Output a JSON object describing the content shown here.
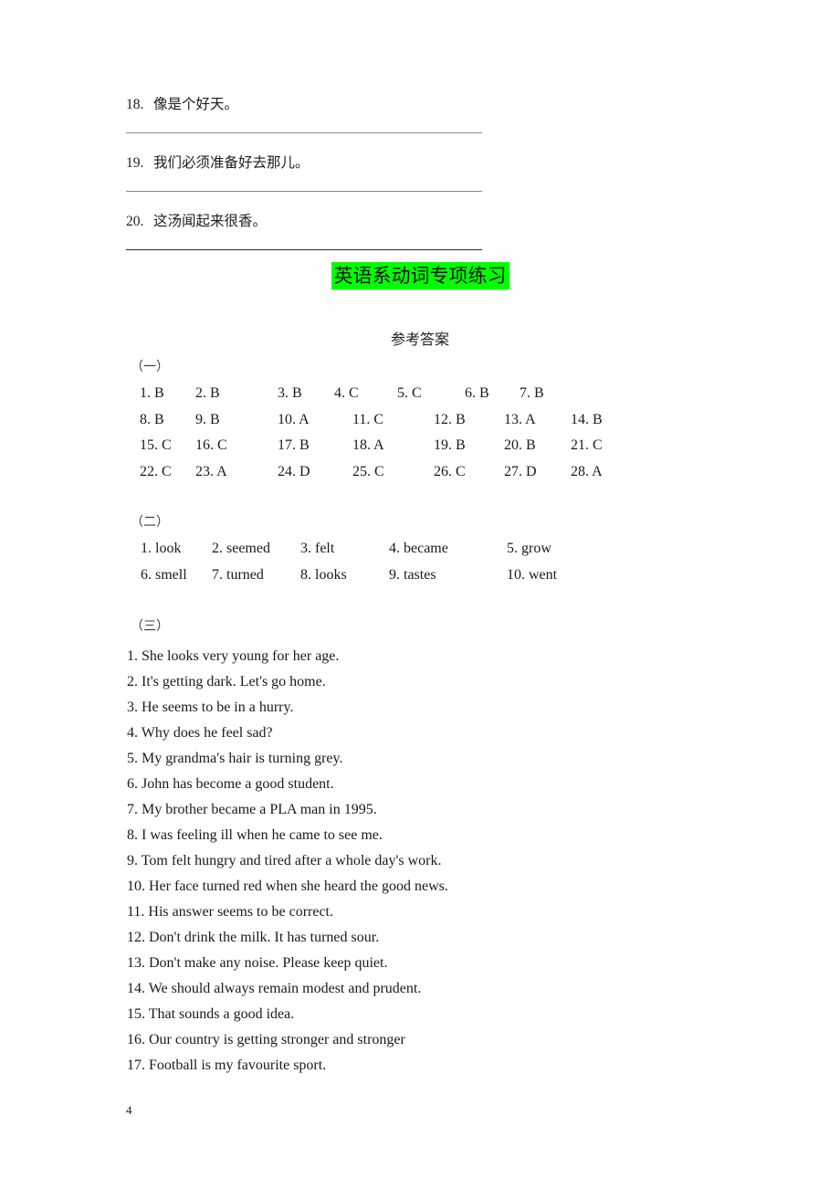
{
  "document": {
    "title_highlighted": "英语系动词专项练习",
    "highlight_color": "#00ff00",
    "answers_heading": "参考答案",
    "page_number": "4"
  },
  "translation_exercise": {
    "items": [
      {
        "number": "18.",
        "text": "像是个好天。"
      },
      {
        "number": "19.",
        "text": "我们必须准备好去那儿。"
      },
      {
        "number": "20.",
        "text": "这汤闻起来很香。"
      }
    ]
  },
  "section_one": {
    "marker": "（一）",
    "rows": [
      [
        {
          "label": "1. B"
        },
        {
          "label": "2. B"
        },
        {
          "label": "3. B"
        },
        {
          "label": "4. C"
        },
        {
          "label": "5. C"
        },
        {
          "label": "6. B"
        },
        {
          "label": "7. B"
        }
      ],
      [
        {
          "label": "8. B"
        },
        {
          "label": "9. B"
        },
        {
          "label": "10. A"
        },
        {
          "label": "11. C"
        },
        {
          "label": "12. B"
        },
        {
          "label": "13. A"
        },
        {
          "label": "14. B"
        }
      ],
      [
        {
          "label": "15. C"
        },
        {
          "label": "16. C"
        },
        {
          "label": "17. B"
        },
        {
          "label": "18. A"
        },
        {
          "label": "19. B"
        },
        {
          "label": "20. B"
        },
        {
          "label": "21. C"
        }
      ],
      [
        {
          "label": "22. C"
        },
        {
          "label": "23. A"
        },
        {
          "label": "24. D"
        },
        {
          "label": "25. C"
        },
        {
          "label": "26. C"
        },
        {
          "label": "27. D"
        },
        {
          "label": "28. A"
        }
      ]
    ],
    "column_x": [
      15,
      76,
      166,
      248,
      337,
      414,
      487
    ]
  },
  "section_two": {
    "marker": "（二）",
    "rows": [
      [
        {
          "label": "1. look"
        },
        {
          "label": "2. seemed"
        },
        {
          "label": "3. felt"
        },
        {
          "label": "4. became"
        },
        {
          "label": "5. grow"
        }
      ],
      [
        {
          "label": "6. smell"
        },
        {
          "label": "7. turned"
        },
        {
          "label": "8. looks"
        },
        {
          "label": "9. tastes"
        },
        {
          "label": "10. went"
        }
      ]
    ],
    "column_x": [
      16,
      94,
      191,
      288,
      417
    ]
  },
  "section_three": {
    "marker": "（三）",
    "sentences": [
      "1. She looks very young for her age.",
      "2. It's getting dark. Let's go home.",
      "3. He seems to be in a hurry.",
      "4. Why does he feel sad?",
      "5. My grandma's hair is turning grey.",
      "6. John has become a good student.",
      "7. My brother became a PLA man in 1995.",
      "8. I was feeling ill when he came to see me.",
      "9. Tom felt hungry and tired after a whole day's work.",
      "10. Her face turned red when she heard the good news.",
      "11. His answer seems to be correct.",
      "12. Don't drink the milk. It has turned sour.",
      "13. Don't make any noise. Please keep quiet.",
      "14. We should always remain modest and prudent.",
      "15. That sounds a good idea.",
      "16. Our country is getting stronger and stronger",
      "17. Football is my favourite sport."
    ]
  }
}
